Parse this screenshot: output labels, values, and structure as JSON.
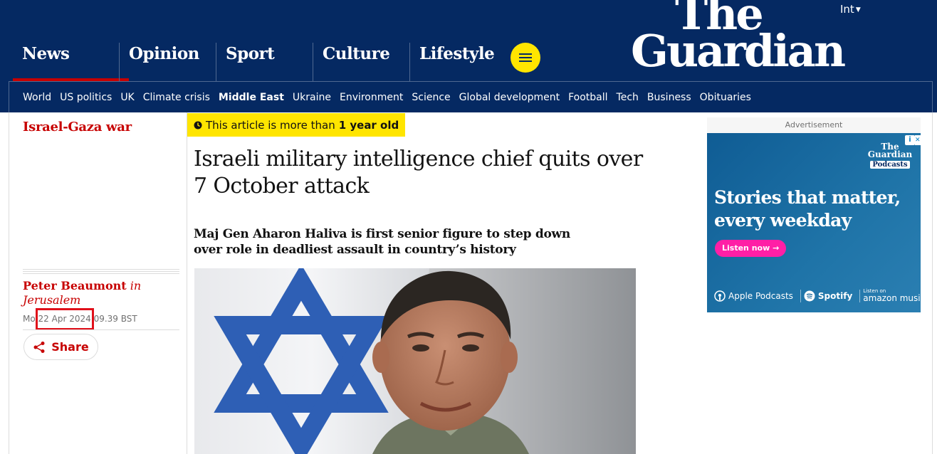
{
  "header": {
    "edition": "Int",
    "logo": {
      "line1": "The",
      "line2": "Guardian"
    },
    "pillars": [
      {
        "label": "News",
        "active": true
      },
      {
        "label": "Opinion",
        "active": false
      },
      {
        "label": "Sport",
        "active": false
      },
      {
        "label": "Culture",
        "active": false
      },
      {
        "label": "Lifestyle",
        "active": false
      }
    ],
    "subnav": [
      "World",
      "US politics",
      "UK",
      "Climate crisis",
      "Middle East",
      "Ukraine",
      "Environment",
      "Science",
      "Global development",
      "Football",
      "Tech",
      "Business",
      "Obituaries"
    ],
    "subnav_active": "Middle East"
  },
  "article": {
    "series": "Israel-Gaza war",
    "age_notice": {
      "prefix": "This article is more than",
      "emphasis": "1 year old"
    },
    "headline": "Israeli military intelligence chief quits over 7 October attack",
    "standfirst": "Maj Gen Aharon Haliva is first senior figure to step down over role in deadliest assault in country’s history",
    "author": "Peter Beaumont",
    "location": "in Jerusalem",
    "date_prefix": "Mo",
    "date": "22 Apr 2024",
    "time": "09.39 BST",
    "share_label": "Share"
  },
  "advert": {
    "label": "Advertisement",
    "logo": {
      "line1": "The",
      "line2": "Guardian",
      "line3": "Podcasts"
    },
    "headline": "Stories that matter, every weekday",
    "cta": "Listen now",
    "platforms": {
      "apple": "Apple Podcasts",
      "spotify": "Spotify",
      "amazon_small": "Listen on",
      "amazon_big": "amazon music"
    }
  },
  "colors": {
    "brand_blue": "#052962",
    "news_red": "#c70000",
    "highlight_yellow": "#ffe500",
    "annotation_red": "#e0101a"
  }
}
